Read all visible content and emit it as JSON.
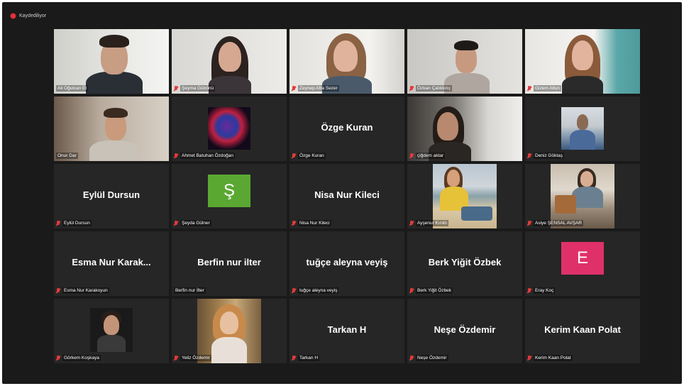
{
  "recording": {
    "label": "Kaydediliyor"
  },
  "accent_colors": {
    "speaking_border": "#b9d43a",
    "muted_mic": "#e23a3a",
    "recording_dot": "#e0353b"
  },
  "participants": [
    {
      "name": "Ali Oğulcan Et",
      "display": "video",
      "muted": false
    },
    {
      "name": "Şeyma Günönü",
      "display": "video",
      "muted": true
    },
    {
      "name": "Zeynep Afra Sezer",
      "display": "video",
      "muted": true
    },
    {
      "name": "Özkan Çalıkkılıç",
      "display": "video",
      "muted": true
    },
    {
      "name": "Gizem Altun",
      "display": "video",
      "muted": true
    },
    {
      "name": "Onur Dar",
      "display": "video",
      "muted": false,
      "speaking": true
    },
    {
      "name": "Ahmet Batuhan Özdoğan",
      "display": "image",
      "muted": true
    },
    {
      "name": "Özge Kuran",
      "display": "name",
      "big_name": "Özge Kuran",
      "muted": true
    },
    {
      "name": "çiğdem aktar",
      "display": "video",
      "muted": true
    },
    {
      "name": "Deniz Göktaş",
      "display": "image",
      "muted": true
    },
    {
      "name": "Eylül Dursun",
      "display": "name",
      "big_name": "Eylül Dursun",
      "muted": true
    },
    {
      "name": "Şeyda Gülner",
      "display": "avatar",
      "avatar_letter": "Ş",
      "avatar_color": "#5aa832",
      "muted": true
    },
    {
      "name": "Nisa Nur Kileci",
      "display": "name",
      "big_name": "Nisa Nur Kileci",
      "muted": true
    },
    {
      "name": "Ayşenur Kırıklı",
      "display": "image",
      "muted": true
    },
    {
      "name": "Asiye ŞENSAL AVŞAR",
      "display": "image",
      "muted": true
    },
    {
      "name": "Esma Nur Karakoyun",
      "display": "name",
      "big_name": "Esma Nur Karak...",
      "muted": true
    },
    {
      "name": "Berfin nur İlter",
      "display": "name",
      "big_name": "Berfin nur ilter",
      "muted": false
    },
    {
      "name": "tuğçe aleyna veyiş",
      "display": "name",
      "big_name": "tuğçe aleyna veyiş",
      "muted": true
    },
    {
      "name": "Berk Yiğit Özbek",
      "display": "name",
      "big_name": "Berk Yiğit Özbek",
      "muted": true
    },
    {
      "name": "Eray Koç",
      "display": "avatar",
      "avatar_letter": "E",
      "avatar_color": "#e0306a",
      "muted": true
    },
    {
      "name": "Görkem Koşkaya",
      "display": "image",
      "muted": true
    },
    {
      "name": "Yeliz Özdemir",
      "display": "image",
      "muted": true
    },
    {
      "name": "Tarkan H",
      "display": "name",
      "big_name": "Tarkan H",
      "muted": true
    },
    {
      "name": "Neşe Özdemir",
      "display": "name",
      "big_name": "Neşe Özdemir",
      "muted": true
    },
    {
      "name": "Kerim Kaan Polat",
      "display": "name",
      "big_name": "Kerim Kaan Polat",
      "muted": true
    }
  ]
}
